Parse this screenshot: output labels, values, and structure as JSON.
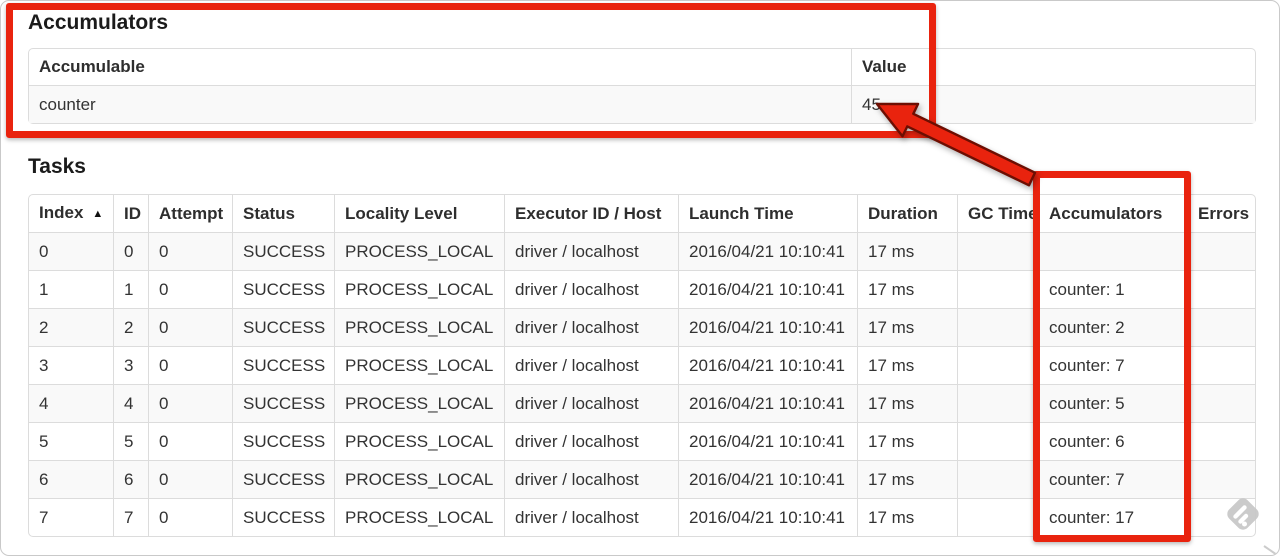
{
  "theme": {
    "annotation_red": "#e9230e",
    "table_border": "#dcdcdc",
    "stripe_bg": "#f9f9f9",
    "text_color": "#333333"
  },
  "accumulators_section": {
    "title": "Accumulators",
    "headers": [
      "Accumulable",
      "Value"
    ],
    "rows": [
      [
        "counter",
        "45"
      ]
    ]
  },
  "tasks_section": {
    "title": "Tasks",
    "sort_icon": "▲",
    "sorted_column": "Index",
    "headers": [
      "Index",
      "ID",
      "Attempt",
      "Status",
      "Locality Level",
      "Executor ID / Host",
      "Launch Time",
      "Duration",
      "GC Time",
      "Accumulators",
      "Errors"
    ],
    "rows": [
      [
        "0",
        "0",
        "0",
        "SUCCESS",
        "PROCESS_LOCAL",
        "driver / localhost",
        "2016/04/21 10:10:41",
        "17 ms",
        "",
        "",
        ""
      ],
      [
        "1",
        "1",
        "0",
        "SUCCESS",
        "PROCESS_LOCAL",
        "driver / localhost",
        "2016/04/21 10:10:41",
        "17 ms",
        "",
        "counter: 1",
        ""
      ],
      [
        "2",
        "2",
        "0",
        "SUCCESS",
        "PROCESS_LOCAL",
        "driver / localhost",
        "2016/04/21 10:10:41",
        "17 ms",
        "",
        "counter: 2",
        ""
      ],
      [
        "3",
        "3",
        "0",
        "SUCCESS",
        "PROCESS_LOCAL",
        "driver / localhost",
        "2016/04/21 10:10:41",
        "17 ms",
        "",
        "counter: 7",
        ""
      ],
      [
        "4",
        "4",
        "0",
        "SUCCESS",
        "PROCESS_LOCAL",
        "driver / localhost",
        "2016/04/21 10:10:41",
        "17 ms",
        "",
        "counter: 5",
        ""
      ],
      [
        "5",
        "5",
        "0",
        "SUCCESS",
        "PROCESS_LOCAL",
        "driver / localhost",
        "2016/04/21 10:10:41",
        "17 ms",
        "",
        "counter: 6",
        ""
      ],
      [
        "6",
        "6",
        "0",
        "SUCCESS",
        "PROCESS_LOCAL",
        "driver / localhost",
        "2016/04/21 10:10:41",
        "17 ms",
        "",
        "counter: 7",
        ""
      ],
      [
        "7",
        "7",
        "0",
        "SUCCESS",
        "PROCESS_LOCAL",
        "driver / localhost",
        "2016/04/21 10:10:41",
        "17 ms",
        "",
        "counter: 17",
        ""
      ]
    ]
  },
  "annotations": {
    "box_around_accumulators_section": true,
    "box_around_accumulators_column": true,
    "arrow_points_to_value": "45"
  },
  "icons": {
    "sort_ascending": "▲",
    "watermark": "feedly-diamond-stamp"
  }
}
